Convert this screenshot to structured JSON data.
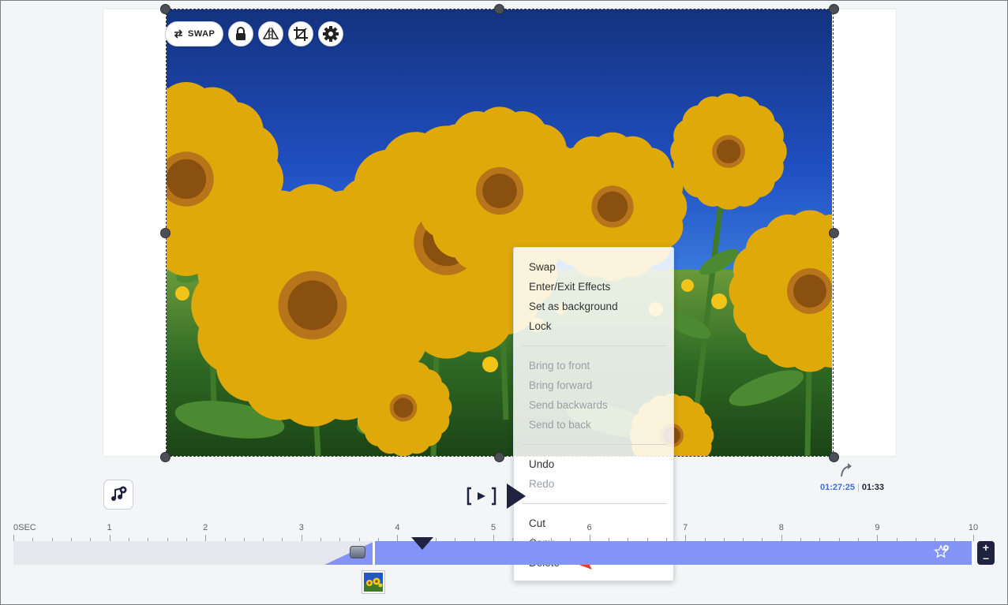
{
  "toolbar": {
    "swap_label": "SWAP",
    "icons": [
      "swap-icon",
      "lock-icon",
      "flip-icon",
      "crop-icon",
      "gear-icon"
    ]
  },
  "context_menu": {
    "items": [
      {
        "label": "Swap",
        "enabled": true
      },
      {
        "label": "Enter/Exit Effects",
        "enabled": true
      },
      {
        "label": "Set as background",
        "enabled": true
      },
      {
        "label": "Lock",
        "enabled": true
      },
      {
        "label": "Bring to front",
        "enabled": false
      },
      {
        "label": "Bring forward",
        "enabled": false
      },
      {
        "label": "Send backwards",
        "enabled": false
      },
      {
        "label": "Send to back",
        "enabled": false
      },
      {
        "label": "Undo",
        "enabled": true
      },
      {
        "label": "Redo",
        "enabled": false
      },
      {
        "label": "Cut",
        "enabled": true
      },
      {
        "label": "Copy",
        "enabled": true
      },
      {
        "label": "Delete",
        "enabled": true
      }
    ],
    "highlighted": "Delete",
    "annotation_color": "#e53935"
  },
  "playback": {
    "current_time": "01:27:25",
    "separator": "|",
    "total_time": "01:33"
  },
  "timeline": {
    "ticks": [
      "0SEC",
      "1",
      "2",
      "3",
      "4",
      "5",
      "6",
      "7",
      "8",
      "9",
      "10"
    ],
    "range_seconds": [
      0,
      10
    ],
    "clip_start_seconds": 3.75,
    "playhead_seconds": 4.27,
    "clip_color": "#8394f6"
  },
  "colors": {
    "accent": "#3f6fd8",
    "dark": "#1f2340",
    "sky": "#1c47b4"
  }
}
